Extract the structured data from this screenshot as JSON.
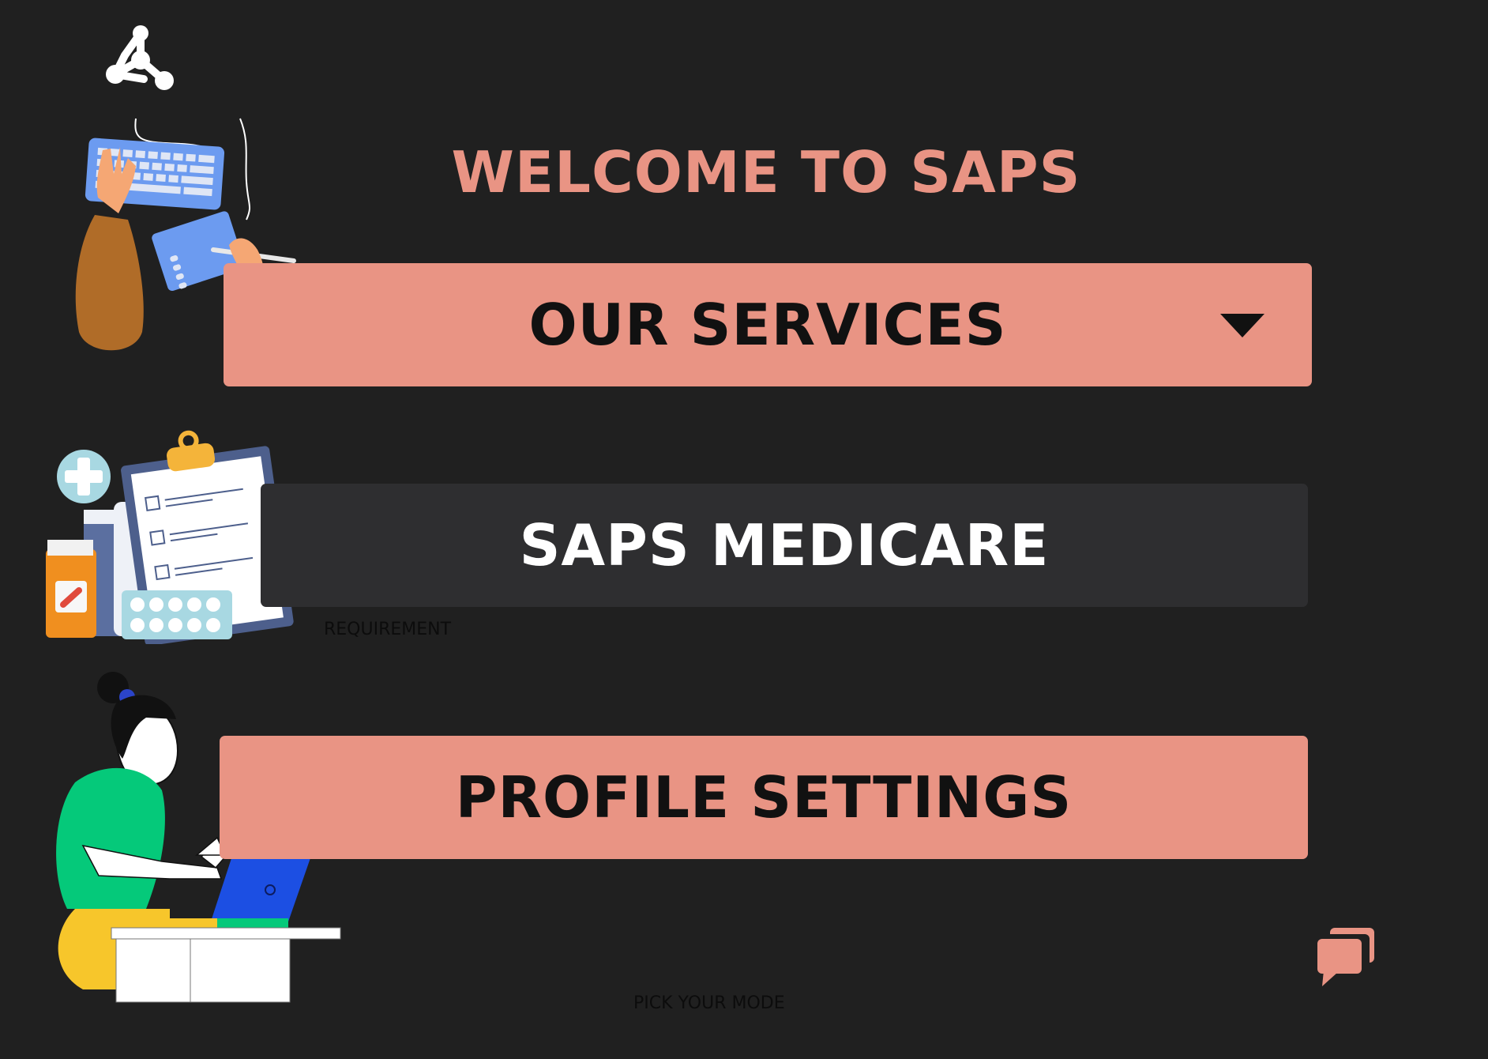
{
  "header": {
    "logo_icon": "network-nodes-icon",
    "title": "WELCOME TO SAPS"
  },
  "menu": {
    "services_label": "OUR SERVICES",
    "services_icon": "triangle-down-icon",
    "medicare_label": "SAPS MEDICARE",
    "profile_label": "PROFILE SETTINGS"
  },
  "captions": {
    "requirement": "REQUIREMENT",
    "pick_mode": "PICK YOUR MODE"
  },
  "icons": {
    "chat": "chat-bubbles-icon",
    "typing_illustration": "typing-hands-illustration",
    "medicine_illustration": "medicine-clipboard-illustration",
    "person_illustration": "person-laptop-illustration"
  },
  "colors": {
    "background": "#202020",
    "accent": "#E99484",
    "dark_button": "#2E2E30",
    "title": "#E99484",
    "button_text_dark": "#111111",
    "button_text_light": "#FFFFFF"
  }
}
